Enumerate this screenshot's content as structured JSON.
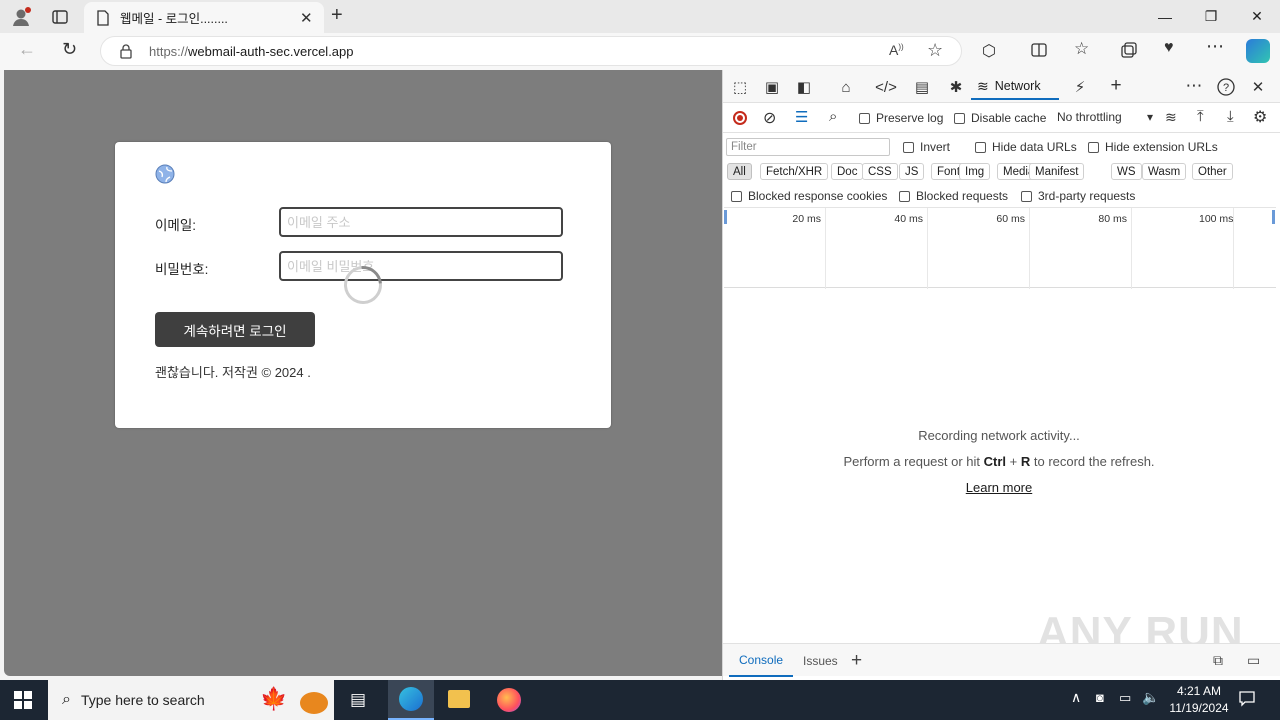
{
  "browser": {
    "tab_title": "웹메일 - 로그인........",
    "url_scheme": "https://",
    "url_host": "webmail-auth-sec.vercel.app"
  },
  "login_form": {
    "email_label": "이메일:",
    "email_placeholder": "이메일 주소",
    "password_label": "비밀번호:",
    "password_placeholder": "이메일 비밀번호",
    "submit_label": "계속하려면 로그인",
    "footer_text": "괜찮습니다. 저작권 © 2024 ."
  },
  "devtools": {
    "network_tab_label": "Network",
    "preserve_log": "Preserve log",
    "disable_cache": "Disable cache",
    "throttling": "No throttling",
    "filter_placeholder": "Filter",
    "invert": "Invert",
    "hide_data_urls": "Hide data URLs",
    "hide_extension_urls": "Hide extension URLs",
    "type_filters": [
      "All",
      "Fetch/XHR",
      "Doc",
      "CSS",
      "JS",
      "Font",
      "Img",
      "Media",
      "Manifest",
      "WS",
      "Wasm",
      "Other"
    ],
    "blocked_response_cookies": "Blocked response cookies",
    "blocked_requests": "Blocked requests",
    "third_party_requests": "3rd-party requests",
    "timeline_ticks": [
      "20 ms",
      "40 ms",
      "60 ms",
      "80 ms",
      "100 ms"
    ],
    "recording_text": "Recording network activity...",
    "hint_prefix": "Perform a request or hit ",
    "hint_key1": "Ctrl",
    "hint_plus": " + ",
    "hint_key2": "R",
    "hint_suffix": " to record the refresh.",
    "learn_more": "Learn more",
    "drawer_tabs": [
      "Console",
      "Issues"
    ]
  },
  "taskbar": {
    "search_placeholder": "Type here to search",
    "time": "4:21 AM",
    "date": "11/19/2024"
  },
  "watermark": "ANY RUN"
}
